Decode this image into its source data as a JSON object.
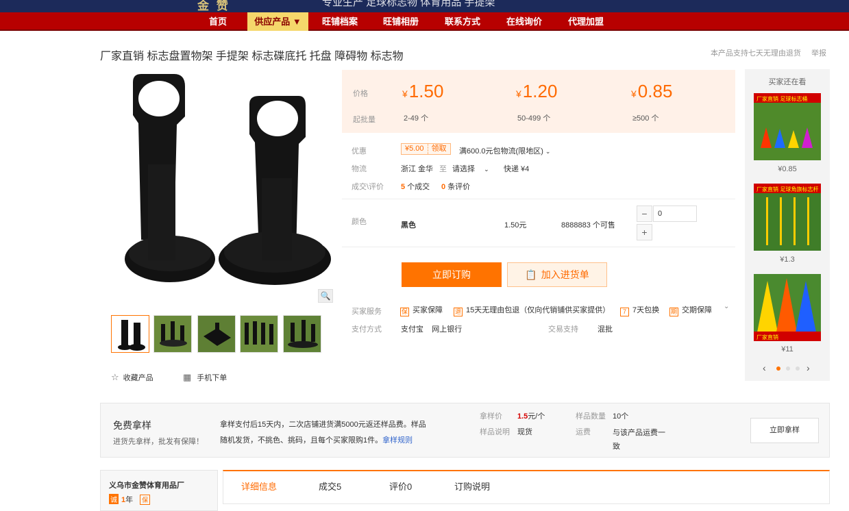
{
  "top": {
    "brand": "金 赞",
    "slogan": "专业生产 足球标志物 体育用品 手提架"
  },
  "nav": {
    "items": [
      "首页",
      "供应产品 ▼",
      "旺铺档案",
      "旺铺相册",
      "联系方式",
      "在线询价",
      "代理加盟"
    ],
    "active_index": 1
  },
  "product": {
    "title": "厂家直销 标志盘置物架 手提架 标志碟底托 托盘 障碍物 标志物",
    "return_note": "本产品支持七天无理由退货",
    "report": "举报"
  },
  "pricing": {
    "price_label": "价格",
    "qty_label": "起批量",
    "currency": "¥",
    "tiers": [
      {
        "price": "1.50",
        "qty": "2-49 个"
      },
      {
        "price": "1.20",
        "qty": "50-499 个"
      },
      {
        "price": "0.85",
        "qty": "≥500 个"
      }
    ]
  },
  "offer": {
    "label": "优惠",
    "coupon": "¥5.00",
    "coupon_get": "领取",
    "free_ship": "满600.0元包物流(限地区)",
    "logistics_label": "物流",
    "from": "浙江 金华",
    "to_word": "至",
    "select": "请选择",
    "express": "快递 ¥4",
    "deal_label": "成交\\评价",
    "deals": "5",
    "deals_unit": "个成交",
    "reviews": "0",
    "reviews_unit": "条评价"
  },
  "sku": {
    "label": "颜色",
    "name": "黑色",
    "price": "1.50元",
    "stock": "8888883 个可售",
    "qty": "0",
    "minus": "−",
    "plus": "+"
  },
  "buttons": {
    "buy": "立即订购",
    "cart": "加入进货单",
    "sample": "立即拿样"
  },
  "services": {
    "label": "买家服务",
    "items": [
      {
        "icon": "保",
        "text": "买家保障"
      },
      {
        "icon": "退",
        "text": "15天无理由包退（仅向代销铺供买家提供）"
      },
      {
        "icon": "7",
        "text": "7天包换"
      },
      {
        "icon": "期",
        "text": "交期保障"
      }
    ],
    "pay_label": "支付方式",
    "pay_methods": "支付宝    网上银行",
    "trade_label": "交易支持",
    "trade_value": "混批"
  },
  "actions": {
    "favorite": "收藏产品",
    "mobile": "手机下单"
  },
  "sidebar": {
    "title": "买家还在看",
    "items": [
      {
        "price": "¥0.85",
        "banner": "厂家直销 足球标志桶"
      },
      {
        "price": "¥1.3",
        "banner": "厂家直销 足球角旗标志杆"
      },
      {
        "price": "¥11",
        "banner": "厂家直销"
      }
    ]
  },
  "sample": {
    "title": "免费拿样",
    "subtitle": "进货先拿样，批发有保障！",
    "desc1": "拿样支付后15天内，二次店铺进货满5000元返还样品费。样品",
    "desc2": "随机发货，不挑色、挑码，且每个买家限购1件。",
    "rule": "拿样规则",
    "price_label": "拿样价",
    "price_value": "1.5",
    "price_unit": "元/个",
    "count_label": "样品数量",
    "count_value": "10个",
    "note_label": "样品说明",
    "note_value": "现货",
    "ship_label": "运费",
    "ship_value": "与该产品运费一致"
  },
  "seller": {
    "name": "义乌市金赞体育用品厂",
    "years": "1",
    "years_unit": "年"
  },
  "tabs": [
    "详细信息",
    "成交5",
    "评价0",
    "订购说明"
  ],
  "colors": {
    "brand_red": "#b70000",
    "accent_orange": "#ff7300",
    "price_orange": "#ff6a00"
  }
}
